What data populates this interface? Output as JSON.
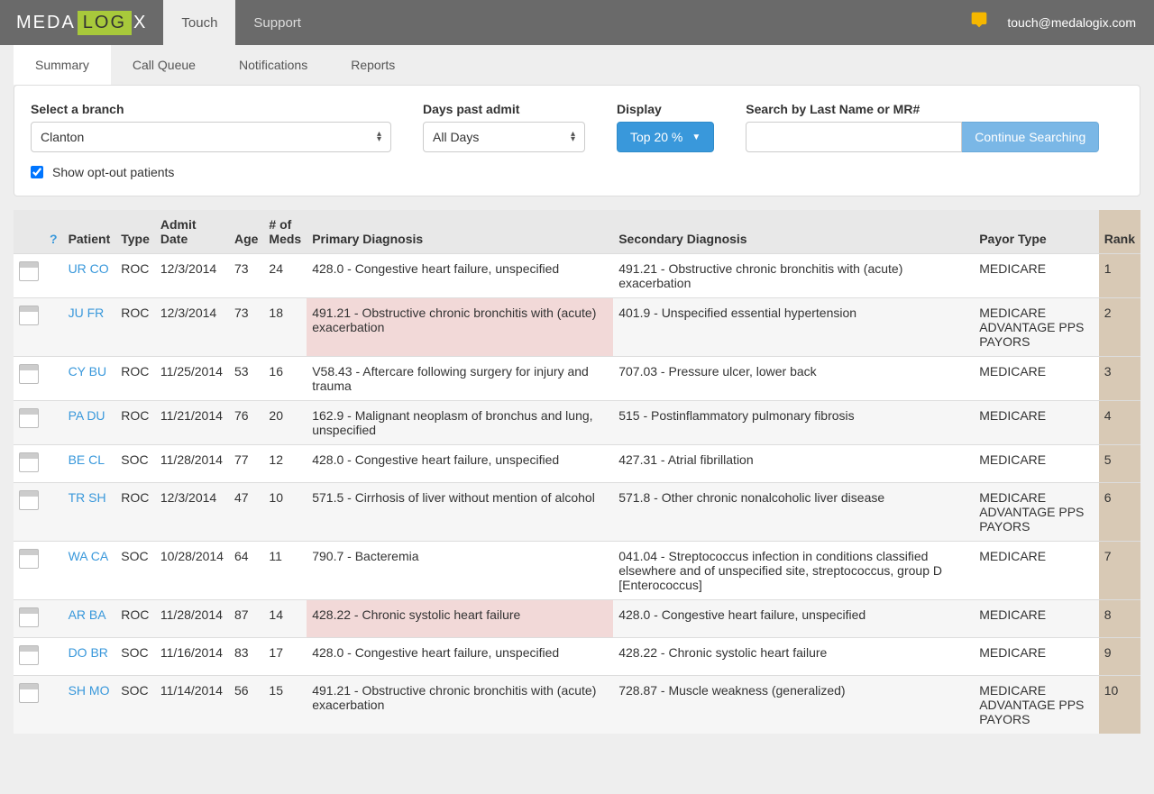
{
  "header": {
    "brand_pre": "MEDA",
    "brand_mid": "LOG",
    "brand_post": "X",
    "nav": [
      "Touch",
      "Support"
    ],
    "email": "touch@medalogix.com"
  },
  "tabs": [
    "Summary",
    "Call Queue",
    "Notifications",
    "Reports"
  ],
  "filters": {
    "branch_label": "Select a branch",
    "branch_value": "Clanton",
    "days_label": "Days past admit",
    "days_value": "All Days",
    "display_label": "Display",
    "display_value": "Top 20 %",
    "search_label": "Search by Last Name or MR#",
    "search_btn": "Continue Searching",
    "optout_label": "Show opt-out patients"
  },
  "columns": {
    "q": "?",
    "patient": "Patient",
    "type": "Type",
    "admit": "Admit Date",
    "age": "Age",
    "meds": "# of Meds",
    "primary": "Primary Diagnosis",
    "secondary": "Secondary Diagnosis",
    "payor": "Payor Type",
    "rank": "Rank"
  },
  "rows": [
    {
      "patient": "UR CO",
      "type": "ROC",
      "admit": "12/3/2014",
      "age": "73",
      "meds": "24",
      "primary": "428.0 - Congestive heart failure, unspecified",
      "secondary": "491.21 - Obstructive chronic bronchitis with (acute) exacerbation",
      "payor": "MEDICARE",
      "rank": "1",
      "hl": false
    },
    {
      "patient": "JU FR",
      "type": "ROC",
      "admit": "12/3/2014",
      "age": "73",
      "meds": "18",
      "primary": "491.21 - Obstructive chronic bronchitis with (acute) exacerbation",
      "secondary": "401.9 - Unspecified essential hypertension",
      "payor": "MEDICARE ADVANTAGE PPS PAYORS",
      "rank": "2",
      "hl": true
    },
    {
      "patient": "CY BU",
      "type": "ROC",
      "admit": "11/25/2014",
      "age": "53",
      "meds": "16",
      "primary": "V58.43 - Aftercare following surgery for injury and trauma",
      "secondary": "707.03 - Pressure ulcer, lower back",
      "payor": "MEDICARE",
      "rank": "3",
      "hl": false
    },
    {
      "patient": "PA DU",
      "type": "ROC",
      "admit": "11/21/2014",
      "age": "76",
      "meds": "20",
      "primary": "162.9 - Malignant neoplasm of bronchus and lung, unspecified",
      "secondary": "515 - Postinflammatory pulmonary fibrosis",
      "payor": "MEDICARE",
      "rank": "4",
      "hl": false
    },
    {
      "patient": "BE CL",
      "type": "SOC",
      "admit": "11/28/2014",
      "age": "77",
      "meds": "12",
      "primary": "428.0 - Congestive heart failure, unspecified",
      "secondary": "427.31 - Atrial fibrillation",
      "payor": "MEDICARE",
      "rank": "5",
      "hl": false
    },
    {
      "patient": "TR SH",
      "type": "ROC",
      "admit": "12/3/2014",
      "age": "47",
      "meds": "10",
      "primary": "571.5 - Cirrhosis of liver without mention of alcohol",
      "secondary": "571.8 - Other chronic nonalcoholic liver disease",
      "payor": "MEDICARE ADVANTAGE PPS PAYORS",
      "rank": "6",
      "hl": false
    },
    {
      "patient": "WA CA",
      "type": "SOC",
      "admit": "10/28/2014",
      "age": "64",
      "meds": "11",
      "primary": "790.7 - Bacteremia",
      "secondary": "041.04 - Streptococcus infection in conditions classified elsewhere and of unspecified site, streptococcus, group D [Enterococcus]",
      "payor": "MEDICARE",
      "rank": "7",
      "hl": false
    },
    {
      "patient": "AR BA",
      "type": "ROC",
      "admit": "11/28/2014",
      "age": "87",
      "meds": "14",
      "primary": "428.22 - Chronic systolic heart failure",
      "secondary": "428.0 - Congestive heart failure, unspecified",
      "payor": "MEDICARE",
      "rank": "8",
      "hl": true
    },
    {
      "patient": "DO BR",
      "type": "SOC",
      "admit": "11/16/2014",
      "age": "83",
      "meds": "17",
      "primary": "428.0 - Congestive heart failure, unspecified",
      "secondary": "428.22 - Chronic systolic heart failure",
      "payor": "MEDICARE",
      "rank": "9",
      "hl": false
    },
    {
      "patient": "SH MO",
      "type": "SOC",
      "admit": "11/14/2014",
      "age": "56",
      "meds": "15",
      "primary": "491.21 - Obstructive chronic bronchitis with (acute) exacerbation",
      "secondary": "728.87 - Muscle weakness (generalized)",
      "payor": "MEDICARE ADVANTAGE PPS PAYORS",
      "rank": "10",
      "hl": false
    }
  ]
}
